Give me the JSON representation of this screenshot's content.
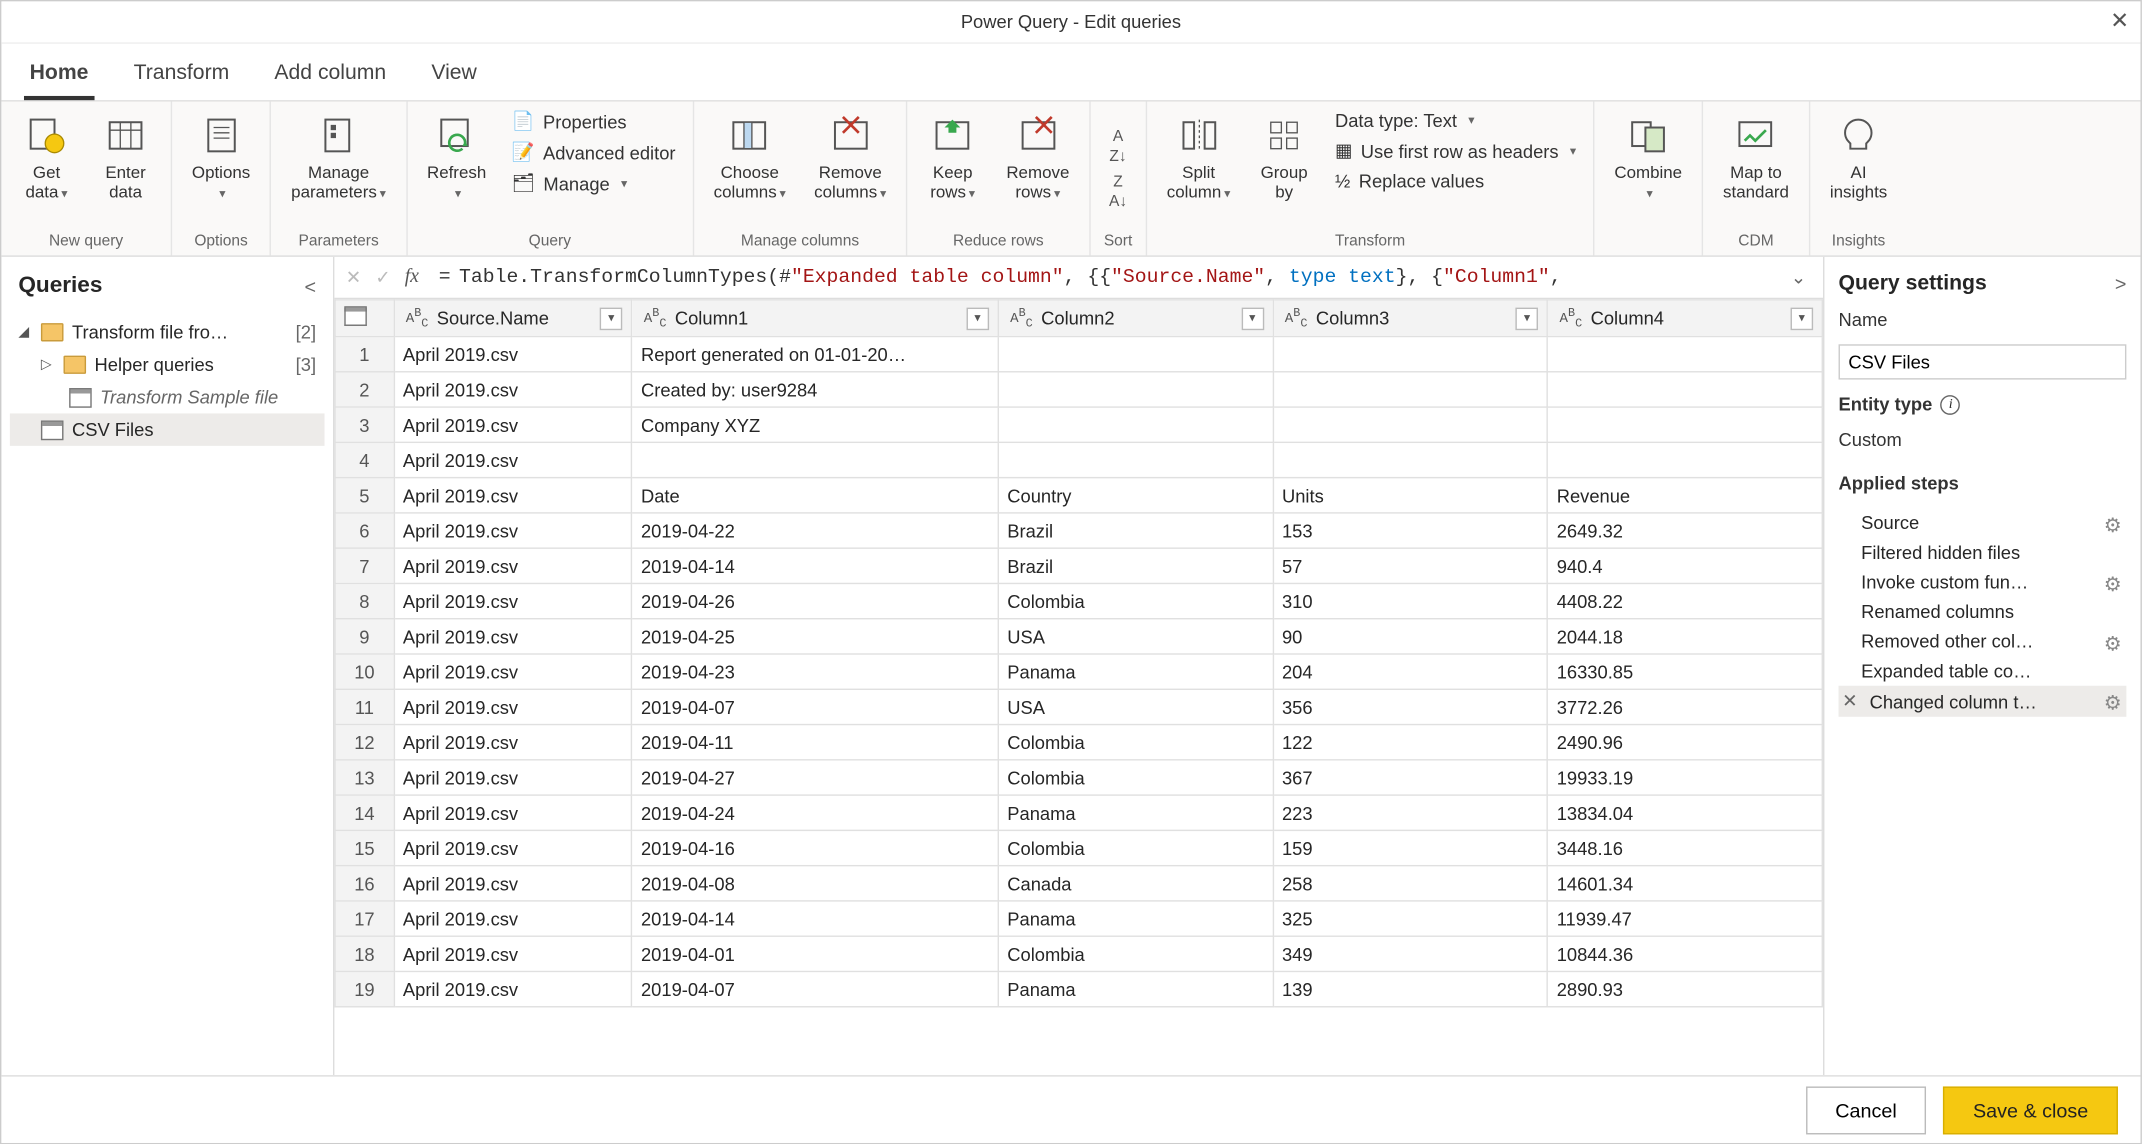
{
  "window": {
    "title": "Power Query - Edit queries"
  },
  "tabs": [
    "Home",
    "Transform",
    "Add column",
    "View"
  ],
  "active_tab": "Home",
  "ribbon": {
    "groups": [
      {
        "label": "New query",
        "buttons": [
          {
            "id": "get-data",
            "label": "Get\ndata",
            "dropdown": true
          },
          {
            "id": "enter-data",
            "label": "Enter\ndata"
          }
        ]
      },
      {
        "label": "Options",
        "buttons": [
          {
            "id": "options",
            "label": "Options",
            "dropdown": true
          }
        ]
      },
      {
        "label": "Parameters",
        "buttons": [
          {
            "id": "manage-parameters",
            "label": "Manage\nparameters",
            "dropdown": true
          }
        ]
      },
      {
        "label": "Query",
        "big": [
          {
            "id": "refresh",
            "label": "Refresh",
            "dropdown": true
          }
        ],
        "small": [
          {
            "id": "properties",
            "label": "Properties"
          },
          {
            "id": "advanced-editor",
            "label": "Advanced editor"
          },
          {
            "id": "manage",
            "label": "Manage",
            "dropdown": true
          }
        ]
      },
      {
        "label": "Manage columns",
        "buttons": [
          {
            "id": "choose-columns",
            "label": "Choose\ncolumns",
            "dropdown": true
          },
          {
            "id": "remove-columns",
            "label": "Remove\ncolumns",
            "dropdown": true
          }
        ]
      },
      {
        "label": "Reduce rows",
        "buttons": [
          {
            "id": "keep-rows",
            "label": "Keep\nrows",
            "dropdown": true
          },
          {
            "id": "remove-rows",
            "label": "Remove\nrows",
            "dropdown": true
          }
        ]
      },
      {
        "label": "Sort",
        "buttons": [
          {
            "id": "sort-asc",
            "label": "A↓Z"
          },
          {
            "id": "sort-desc",
            "label": "Z↓A"
          }
        ]
      },
      {
        "label": "Transform",
        "big": [
          {
            "id": "split-column",
            "label": "Split\ncolumn",
            "dropdown": true
          },
          {
            "id": "group-by",
            "label": "Group\nby"
          }
        ],
        "small": [
          {
            "id": "data-type",
            "label": "Data type: Text",
            "dropdown": true
          },
          {
            "id": "first-row-headers",
            "label": "Use first row as headers",
            "dropdown": true
          },
          {
            "id": "replace-values",
            "label": "Replace values"
          }
        ]
      },
      {
        "label": "",
        "buttons": [
          {
            "id": "combine",
            "label": "Combine",
            "dropdown": true
          }
        ]
      },
      {
        "label": "CDM",
        "buttons": [
          {
            "id": "map-to-standard",
            "label": "Map to\nstandard"
          }
        ]
      },
      {
        "label": "Insights",
        "buttons": [
          {
            "id": "ai-insights",
            "label": "AI\ninsights"
          }
        ]
      }
    ]
  },
  "queries_panel": {
    "title": "Queries",
    "items": [
      {
        "type": "folder",
        "label": "Transform file fro…",
        "count": "[2]",
        "expanded": true,
        "indent": 0
      },
      {
        "type": "folder",
        "label": "Helper queries",
        "count": "[3]",
        "expanded": false,
        "indent": 1
      },
      {
        "type": "table",
        "label": "Transform Sample file",
        "italic": true,
        "indent": 2
      },
      {
        "type": "table",
        "label": "CSV Files",
        "selected": true,
        "indent": 1
      }
    ]
  },
  "formula": {
    "prefix": "Table.TransformColumnTypes(#",
    "str1": "\"Expanded table column\"",
    "mid": ", {{",
    "str2": "\"Source.Name\"",
    "mid2": ", ",
    "kw1": "type",
    "kw2": "text",
    "mid3": "}, {",
    "str3": "\"Column1\"",
    "tail": ","
  },
  "grid": {
    "columns": [
      "Source.Name",
      "Column1",
      "Column2",
      "Column3",
      "Column4"
    ],
    "rows": [
      [
        "April 2019.csv",
        "Report generated on 01-01-20…",
        "",
        "",
        ""
      ],
      [
        "April 2019.csv",
        "Created by: user9284",
        "",
        "",
        ""
      ],
      [
        "April 2019.csv",
        "Company XYZ",
        "",
        "",
        ""
      ],
      [
        "April 2019.csv",
        "",
        "",
        "",
        ""
      ],
      [
        "April 2019.csv",
        "Date",
        "Country",
        "Units",
        "Revenue"
      ],
      [
        "April 2019.csv",
        "2019-04-22",
        "Brazil",
        "153",
        "2649.32"
      ],
      [
        "April 2019.csv",
        "2019-04-14",
        "Brazil",
        "57",
        "940.4"
      ],
      [
        "April 2019.csv",
        "2019-04-26",
        "Colombia",
        "310",
        "4408.22"
      ],
      [
        "April 2019.csv",
        "2019-04-25",
        "USA",
        "90",
        "2044.18"
      ],
      [
        "April 2019.csv",
        "2019-04-23",
        "Panama",
        "204",
        "16330.85"
      ],
      [
        "April 2019.csv",
        "2019-04-07",
        "USA",
        "356",
        "3772.26"
      ],
      [
        "April 2019.csv",
        "2019-04-11",
        "Colombia",
        "122",
        "2490.96"
      ],
      [
        "April 2019.csv",
        "2019-04-27",
        "Colombia",
        "367",
        "19933.19"
      ],
      [
        "April 2019.csv",
        "2019-04-24",
        "Panama",
        "223",
        "13834.04"
      ],
      [
        "April 2019.csv",
        "2019-04-16",
        "Colombia",
        "159",
        "3448.16"
      ],
      [
        "April 2019.csv",
        "2019-04-08",
        "Canada",
        "258",
        "14601.34"
      ],
      [
        "April 2019.csv",
        "2019-04-14",
        "Panama",
        "325",
        "11939.47"
      ],
      [
        "April 2019.csv",
        "2019-04-01",
        "Colombia",
        "349",
        "10844.36"
      ],
      [
        "April 2019.csv",
        "2019-04-07",
        "Panama",
        "139",
        "2890.93"
      ]
    ]
  },
  "query_settings": {
    "title": "Query settings",
    "name_label": "Name",
    "name_value": "CSV Files",
    "entity_label": "Entity type",
    "entity_value": "Custom",
    "steps_label": "Applied steps",
    "steps": [
      {
        "label": "Source",
        "gear": true
      },
      {
        "label": "Filtered hidden files",
        "gear": false
      },
      {
        "label": "Invoke custom fun…",
        "gear": true
      },
      {
        "label": "Renamed columns",
        "gear": false
      },
      {
        "label": "Removed other col…",
        "gear": true
      },
      {
        "label": "Expanded table co…",
        "gear": false
      },
      {
        "label": "Changed column t…",
        "gear": true,
        "selected": true,
        "deletable": true
      }
    ]
  },
  "footer": {
    "cancel": "Cancel",
    "save": "Save & close"
  }
}
